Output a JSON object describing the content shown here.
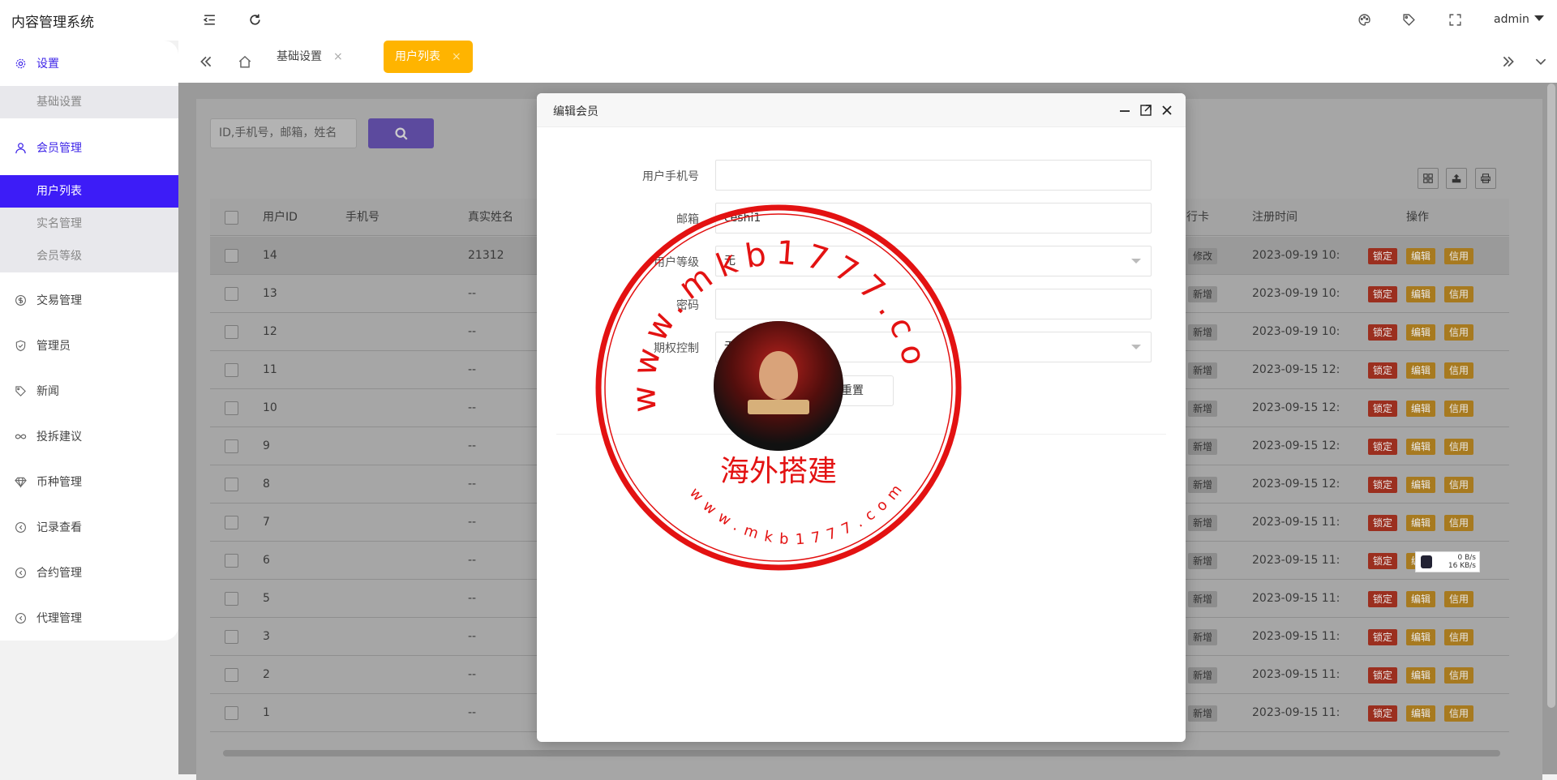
{
  "app": {
    "title": "内容管理系统",
    "user": "admin"
  },
  "sidebar": {
    "groups": [
      {
        "label": "设置",
        "icon": "gear-icon",
        "subs": [
          "基础设置"
        ]
      },
      {
        "label": "会员管理",
        "icon": "user-icon",
        "subs": [
          "用户列表",
          "实名管理",
          "会员等级"
        ]
      },
      {
        "label": "交易管理",
        "icon": "dollar-icon"
      },
      {
        "label": "管理员",
        "icon": "shield-icon"
      },
      {
        "label": "新闻",
        "icon": "tag-icon"
      },
      {
        "label": "投拆建议",
        "icon": "infinity-icon"
      },
      {
        "label": "币种管理",
        "icon": "diamond-icon"
      },
      {
        "label": "记录查看",
        "icon": "circle-arrow-icon"
      },
      {
        "label": "合约管理",
        "icon": "circle-arrow-icon"
      },
      {
        "label": "代理管理",
        "icon": "circle-arrow-icon"
      }
    ]
  },
  "tabs": [
    {
      "label": "基础设置",
      "close": "×"
    },
    {
      "label": "用户列表",
      "close": "×"
    }
  ],
  "search": {
    "placeholder": "ID,手机号，邮箱，姓名"
  },
  "table": {
    "headers": [
      "用户ID",
      "手机号",
      "真实姓名",
      "行卡",
      "注册时间",
      "操作"
    ],
    "rows": [
      {
        "id": "14",
        "name": "21312",
        "card": "修改",
        "time": "2023-09-19 10:"
      },
      {
        "id": "13",
        "name": "--",
        "card": "新增",
        "time": "2023-09-19 10:"
      },
      {
        "id": "12",
        "name": "--",
        "card": "新增",
        "time": "2023-09-19 10:"
      },
      {
        "id": "11",
        "name": "--",
        "card": "新增",
        "time": "2023-09-15 12:"
      },
      {
        "id": "10",
        "name": "--",
        "card": "新增",
        "time": "2023-09-15 12:"
      },
      {
        "id": "9",
        "name": "--",
        "card": "新增",
        "time": "2023-09-15 12:"
      },
      {
        "id": "8",
        "name": "--",
        "card": "新增",
        "time": "2023-09-15 12:"
      },
      {
        "id": "7",
        "name": "--",
        "card": "新增",
        "time": "2023-09-15 11:"
      },
      {
        "id": "6",
        "name": "--",
        "card": "新增",
        "time": "2023-09-15 11:"
      },
      {
        "id": "5",
        "name": "--",
        "card": "新增",
        "time": "2023-09-15 11:"
      },
      {
        "id": "3",
        "name": "--",
        "card": "新增",
        "time": "2023-09-15 11:"
      },
      {
        "id": "2",
        "name": "--",
        "card": "新增",
        "time": "2023-09-15 11:"
      },
      {
        "id": "1",
        "name": "--",
        "card": "新增",
        "time": "2023-09-15 11:"
      }
    ],
    "actions": {
      "lock": "锁定",
      "edit": "编辑",
      "credit": "信用"
    }
  },
  "modal": {
    "title": "编辑会员",
    "fields": [
      {
        "label": "用户手机号",
        "value": ""
      },
      {
        "label": "邮箱",
        "value": "ceshi1"
      },
      {
        "label": "用户等级",
        "value": "无"
      },
      {
        "label": "密码",
        "value": ""
      },
      {
        "label": "期权控制",
        "value": "无"
      }
    ],
    "reset": "重置"
  },
  "watermark": {
    "url_top": "www.mkb1777.com",
    "text": "海外搭建",
    "url_bottom": "www.mkb1777.com"
  },
  "speed": {
    "up": "0 B/s",
    "down": "16 KB/s"
  },
  "colors": {
    "accent": "#3d1cf7",
    "tab_active": "#ffb400",
    "lock": "#e2411c",
    "edit": "#f5a623",
    "search_btn": "#6a4fd8"
  }
}
